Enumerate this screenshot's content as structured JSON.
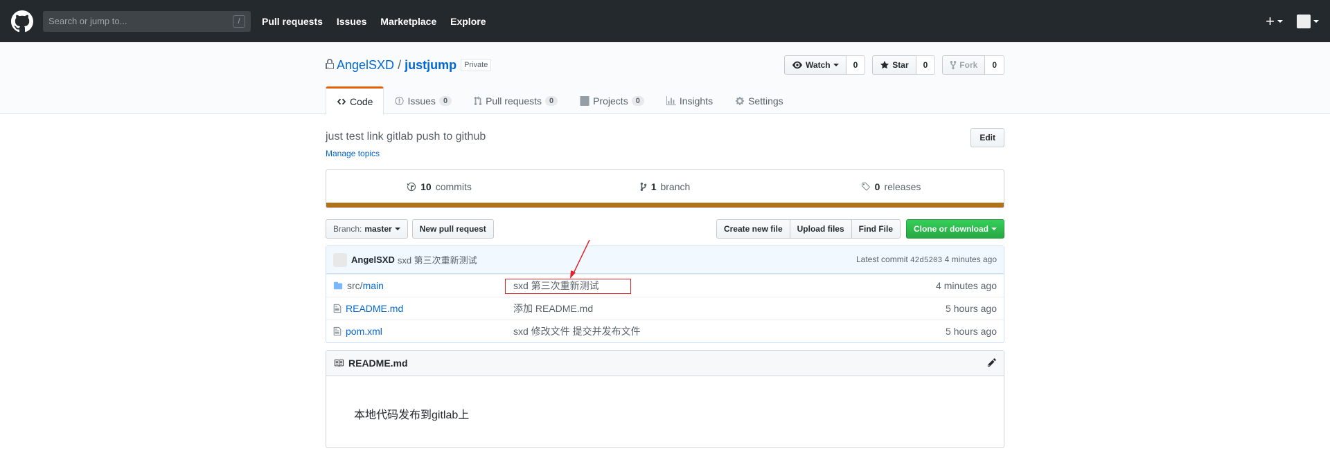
{
  "header": {
    "search_placeholder": "Search or jump to...",
    "slash_key": "/",
    "nav": [
      "Pull requests",
      "Issues",
      "Marketplace",
      "Explore"
    ],
    "plus": "+"
  },
  "repo": {
    "owner": "AngelSXD",
    "separator": "/",
    "name": "justjump",
    "visibility": "Private",
    "watch": {
      "label": "Watch",
      "count": "0"
    },
    "star": {
      "label": "Star",
      "count": "0"
    },
    "fork": {
      "label": "Fork",
      "count": "0"
    }
  },
  "tabs": [
    {
      "label": "Code",
      "count": ""
    },
    {
      "label": "Issues",
      "count": "0"
    },
    {
      "label": "Pull requests",
      "count": "0"
    },
    {
      "label": "Projects",
      "count": "0"
    },
    {
      "label": "Insights",
      "count": ""
    },
    {
      "label": "Settings",
      "count": ""
    }
  ],
  "description": "just test link gitlab push to github",
  "edit_label": "Edit",
  "manage_topics": "Manage topics",
  "summary": {
    "commits_num": "10",
    "commits_label": "commits",
    "branch_num": "1",
    "branch_label": "branch",
    "releases_num": "0",
    "releases_label": "releases"
  },
  "language_color": "#b07219",
  "filebar": {
    "branch_prefix": "Branch:",
    "branch_name": "master",
    "new_pr": "New pull request",
    "create_file": "Create new file",
    "upload": "Upload files",
    "find": "Find File",
    "clone": "Clone or download"
  },
  "latest_commit": {
    "author": "AngelSXD",
    "message": "sxd 第三次重新测试",
    "prefix": "Latest commit",
    "sha": "42d5203",
    "age": "4 minutes ago"
  },
  "files": [
    {
      "type": "dir",
      "prefix": "src/",
      "name": "main",
      "message": "sxd 第三次重新测试",
      "age": "4 minutes ago"
    },
    {
      "type": "file",
      "prefix": "",
      "name": "README.md",
      "message": "添加 README.md",
      "age": "5 hours ago"
    },
    {
      "type": "file",
      "prefix": "",
      "name": "pom.xml",
      "message": "sxd 修改文件 提交并发布文件",
      "age": "5 hours ago"
    }
  ],
  "readme": {
    "title": "README.md",
    "body": "本地代码发布到gitlab上"
  }
}
